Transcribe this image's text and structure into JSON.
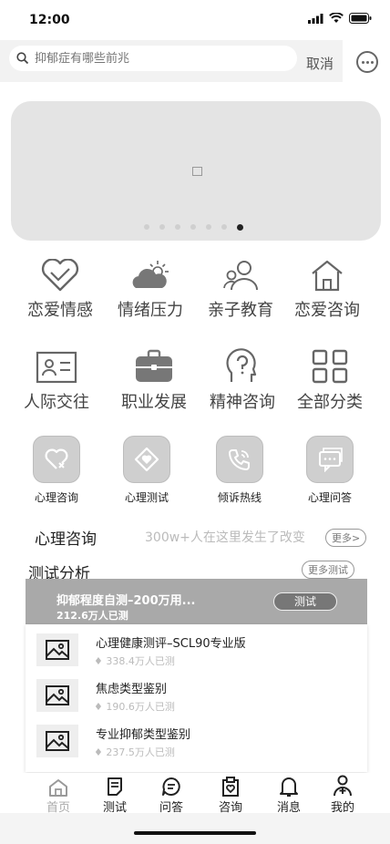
{
  "status": {
    "time": "12:00"
  },
  "search": {
    "placeholder": "抑郁症有哪些前兆",
    "cancel": "取消"
  },
  "banner": {
    "dot_count": 7,
    "active_index": 6
  },
  "categories": [
    {
      "label": "恋爱情感",
      "icon": "heart-icon"
    },
    {
      "label": "情绪压力",
      "icon": "cloud-sun-icon"
    },
    {
      "label": "亲子教育",
      "icon": "family-icon"
    },
    {
      "label": "恋爱咨询",
      "icon": "home-icon"
    },
    {
      "label": "人际交往",
      "icon": "id-card-icon"
    },
    {
      "label": "职业发展",
      "icon": "briefcase-icon"
    },
    {
      "label": "精神咨询",
      "icon": "head-icon"
    },
    {
      "label": "全部分类",
      "icon": "grid-icon"
    }
  ],
  "services": [
    {
      "label": "心理咨询",
      "icon": "heart-x-icon"
    },
    {
      "label": "心理测试",
      "icon": "diamond-heart-icon"
    },
    {
      "label": "倾诉热线",
      "icon": "phone-icon"
    },
    {
      "label": "心理问答",
      "icon": "chat-icon"
    }
  ],
  "consult": {
    "title": "心理咨询",
    "subtitle": "300w+人在这里发生了改变",
    "more": "更多"
  },
  "tests": {
    "title": "测试分析",
    "more": "更多测试",
    "featured": {
      "title": "抑郁程度自测–200万用...",
      "count": "212.6万人已测",
      "button": "测试"
    },
    "items": [
      {
        "title": "心理健康测评–SCL90专业版",
        "count": "338.4万人已测"
      },
      {
        "title": "焦虑类型鉴别",
        "count": "190.6万人已测"
      },
      {
        "title": "专业抑郁类型鉴别",
        "count": "237.5万人已测"
      }
    ]
  },
  "tabs": [
    {
      "label": "首页",
      "icon": "home-tab-icon"
    },
    {
      "label": "测试",
      "icon": "document-icon"
    },
    {
      "label": "问答",
      "icon": "chat-bubble-icon"
    },
    {
      "label": "咨询",
      "icon": "clipboard-heart-icon"
    },
    {
      "label": "消息",
      "icon": "bell-icon"
    },
    {
      "label": "我的",
      "icon": "user-icon"
    }
  ]
}
